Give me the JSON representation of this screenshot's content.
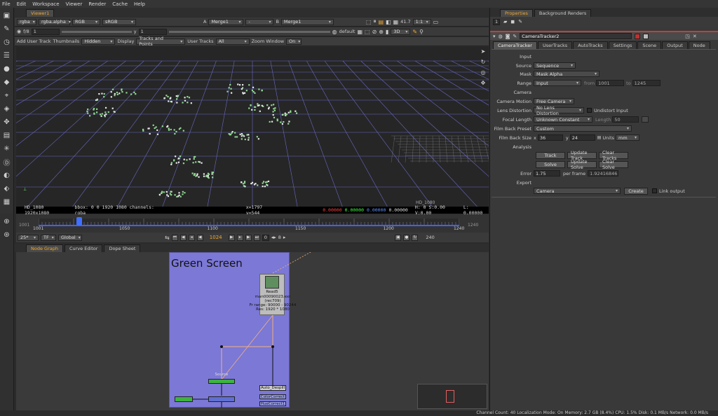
{
  "menu": [
    "File",
    "Edit",
    "Workspace",
    "Viewer",
    "Render",
    "Cache",
    "Help"
  ],
  "viewer": {
    "tab": "Viewer1",
    "channels": "rgba",
    "alpha": "rgba.alpha",
    "colorspace": "RGB",
    "lut": "sRGB",
    "a_label": "A",
    "a_input": "Merge1",
    "a_op": "-",
    "b_label": "B",
    "b_input": "Merge1",
    "zoom_val": "41.7",
    "zoom_ratio": "1:1",
    "fstop": "f/8",
    "frame_chk": "1",
    "y_label": "y",
    "y_value": "1",
    "default_label": "default",
    "mode3d": "3D",
    "add_user_track": "Add User Track",
    "thumbnails_label": "Thumbnails",
    "thumbnails_value": "Hidden",
    "display_label": "Display",
    "display_value": "Tracks and Points",
    "user_tracks_label": "User Tracks",
    "user_tracks_value": "All",
    "zoom_window_label": "Zoom Window",
    "zoom_window_value": "On",
    "format_label": "HD_1080",
    "info_format": "HD_1080 1920x1080",
    "info_bbox": "bbox: 0 0 1920 1080 channels: rgba",
    "info_xy": "x=1797 y=544",
    "info_r": "0.00000",
    "info_g": "0.00000",
    "info_b": "0.00000",
    "info_a": "0.00000",
    "info_hsv": "H: 0 S:0.00 V:0.00",
    "info_l": "L: 0.00000"
  },
  "timeline": {
    "start": "1001",
    "end": "1240",
    "ticks": [
      "1001",
      "1050",
      "1100",
      "1150",
      "1200",
      "1240"
    ],
    "fps": "25*",
    "tf": "TF",
    "global": "Global",
    "current": "1024",
    "step": "8",
    "end_field": "240",
    "zero_field": "0",
    "playhead_value": 1024
  },
  "panels": {
    "node_graph": "Node Graph",
    "curve_editor": "Curve Editor",
    "dope_sheet": "Dope Sheet"
  },
  "nodegraph": {
    "backdrop_title": "Green Screen",
    "read_name": "Read5",
    "read_file": "man00090023.exr",
    "read_cs": "(rec709)",
    "read_range": "Fr range: 90000 - 90244",
    "read_res": "Res: 1920 * 1080",
    "source_label": "Source",
    "auto_despill": "Auto_Despill",
    "color_correct": "ColorCorrect",
    "hue_correct": "HueCorrect1",
    "status_text": "Channel Count: 40  Localization Mode: On  Memory: 2.7 GB (8.4%)  CPU: 1.5%  Disk: 0.1 MB/s  Network: 0.0 MB/s"
  },
  "properties": {
    "tabs": [
      "Properties",
      "Background Renders"
    ],
    "count": "1",
    "node_name": "CameraTracker2",
    "node_tabs": [
      "CameraTracker",
      "UserTracks",
      "AutoTracks",
      "Settings",
      "Scene",
      "Output",
      "Node"
    ],
    "input_header": "Input",
    "source_label": "Source",
    "source_value": "Sequence",
    "mask_label": "Mask",
    "mask_value": "Mask Alpha",
    "range_label": "Range",
    "range_value": "Input",
    "from_label": "from",
    "from_value": "1001",
    "to_label": "to",
    "to_value": "1245",
    "camera_header": "Camera",
    "motion_label": "Camera Motion",
    "motion_value": "Free Camera",
    "lens_label": "Lens Distortion",
    "lens_value": "No Lens Distortion",
    "undistort_label": "Undistort Input",
    "focal_label": "Focal Length",
    "focal_value": "Unknown Constant",
    "length_label": "Length",
    "length_value": "50",
    "filmback_label": "Film Back Preset",
    "filmback_value": "Custom",
    "fbsize_label": "Film Back Size",
    "x_label": "x",
    "x_value": "36",
    "y_label": "y",
    "y_value": "24",
    "units_label": "Units",
    "units_value": "mm",
    "analysis_header": "Analysis",
    "track_btn": "Track",
    "update_track_btn": "Update Track",
    "clear_tracks_btn": "Clear Tracks",
    "solve_btn": "Solve",
    "update_solve_btn": "Update Solve",
    "clear_solve_btn": "Clear Solve",
    "error_label": "Error",
    "error_value": "1.75",
    "per_frame_label": "per frame",
    "per_frame_value": "1.92416846",
    "export_header": "Export",
    "export_value": "Camera",
    "create_btn": "Create",
    "link_label": "Link output"
  }
}
